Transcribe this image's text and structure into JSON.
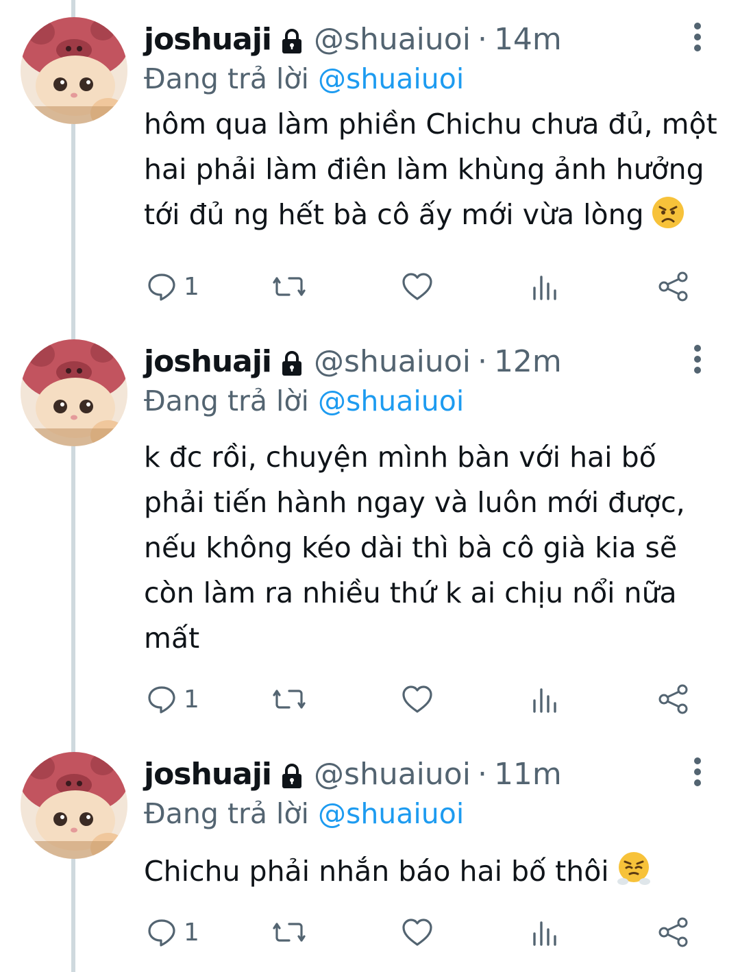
{
  "tweets": [
    {
      "name": "joshuaji",
      "handle": "@shuaiuoi",
      "separator": "·",
      "time": "14m",
      "reply_prefix": "Đang trả lời",
      "reply_to": "@shuaiuoi",
      "text": "hôm qua làm phiền Chichu chưa đủ, một hai phải làm điên làm khùng ảnh hưởng tới đủ ng hết bà cô ấy mới vừa lòng",
      "emoji": "angry-face",
      "reply_count": "1"
    },
    {
      "name": "joshuaji",
      "handle": "@shuaiuoi",
      "separator": "·",
      "time": "12m",
      "reply_prefix": "Đang trả lời",
      "reply_to": "@shuaiuoi",
      "text": "k đc rồi, chuyện mình bàn với hai bố phải tiến hành ngay và luôn mới được, nếu không kéo dài thì bà cô già kia sẽ còn làm ra nhiều thứ k ai chịu nổi nữa mất",
      "emoji": "",
      "reply_count": "1"
    },
    {
      "name": "joshuaji",
      "handle": "@shuaiuoi",
      "separator": "·",
      "time": "11m",
      "reply_prefix": "Đang trả lời",
      "reply_to": "@shuaiuoi",
      "text": "Chichu phải nhắn báo hai bố thôi",
      "emoji": "face-with-steam-from-nose",
      "reply_count": "1"
    }
  ],
  "colors": {
    "text": "#0f1419",
    "secondary": "#536471",
    "mention": "#1d9bf0",
    "thread_line": "#cfd9de"
  },
  "icons": [
    "lock-icon",
    "more-icon",
    "reply-icon",
    "retweet-icon",
    "like-icon",
    "views-icon",
    "share-icon"
  ]
}
